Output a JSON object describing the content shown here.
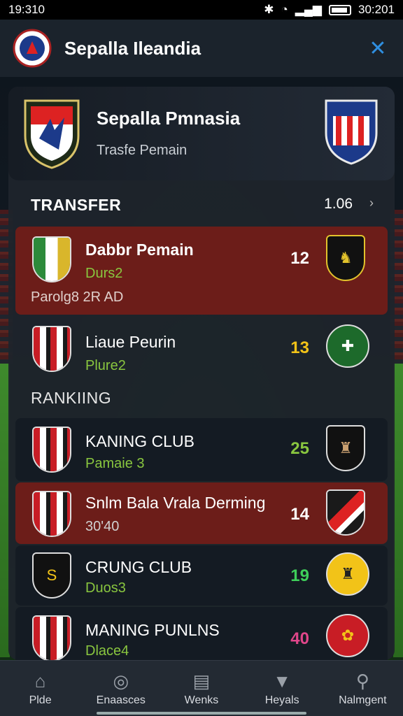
{
  "status": {
    "time": "19:310",
    "right_time": "30:201",
    "bluetooth_icon": "bluetooth-icon",
    "wifi_icon": "wifi-icon",
    "signal_icon": "signal-icon"
  },
  "appbar": {
    "title": "Sepalla Ileandia",
    "close_icon": "close-icon"
  },
  "hero": {
    "title": "Sepalla Pmnasia",
    "subtitle": "Trasfe Pemain"
  },
  "transfer": {
    "heading": "TRANSFER",
    "value": "1.06",
    "rows": [
      {
        "name": "Dabbr Pemain",
        "sub": "Durs2",
        "number": "12",
        "extra": "Parolg8 2R AD"
      },
      {
        "name": "Liaue Peurin",
        "sub": "Plure2",
        "number": "13"
      }
    ]
  },
  "ranking": {
    "heading": "RANKIING",
    "rows": [
      {
        "name": "KANING CLUB",
        "sub": "Pamaie 3",
        "number": "25"
      },
      {
        "name": "Snlm Bala Vrala Derming",
        "sub": "30'40",
        "number": "14"
      },
      {
        "name": "CRUNG CLUB",
        "sub": "Duos3",
        "number": "19"
      },
      {
        "name": "MANING PUNLNS",
        "sub": "Dlace4",
        "number": "40"
      }
    ]
  },
  "colors": {
    "accent": "#2f8fe0",
    "green": "#89c63f",
    "yellow": "#f2c318",
    "pink": "#e0468a",
    "red_row": "#6c1d19"
  },
  "nav": [
    {
      "label": "Plde",
      "icon": "home-icon"
    },
    {
      "label": "Enaasces",
      "icon": "ball-icon"
    },
    {
      "label": "Wenks",
      "icon": "chat-icon"
    },
    {
      "label": "Heyals",
      "icon": "shirt-icon"
    },
    {
      "label": "Nalmgent",
      "icon": "search-icon"
    }
  ]
}
